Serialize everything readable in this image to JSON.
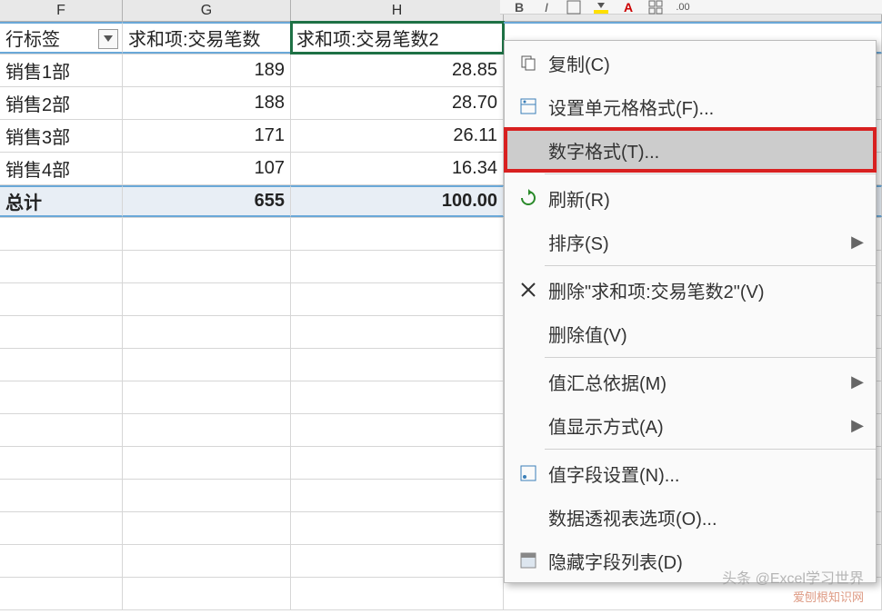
{
  "columns": {
    "F": "F",
    "G": "G",
    "H": "H"
  },
  "pivot": {
    "headers": {
      "row_label": "行标签",
      "sum_field1": "求和项:交易笔数",
      "sum_field2": "求和项:交易笔数2"
    },
    "rows": [
      {
        "label": "销售1部",
        "v1": "189",
        "v2": "28.85"
      },
      {
        "label": "销售2部",
        "v1": "188",
        "v2": "28.70"
      },
      {
        "label": "销售3部",
        "v1": "171",
        "v2": "26.11"
      },
      {
        "label": "销售4部",
        "v1": "107",
        "v2": "16.34"
      }
    ],
    "total": {
      "label": "总计",
      "v1": "655",
      "v2": "100.00"
    }
  },
  "context_menu": {
    "items": [
      {
        "icon": "copy-icon",
        "label": "复制(C)",
        "sep_after": false
      },
      {
        "icon": "format-cells-icon",
        "label": "设置单元格格式(F)...",
        "sep_after": false
      },
      {
        "icon": "",
        "label": "数字格式(T)...",
        "highlighted": true,
        "sep_after": true
      },
      {
        "icon": "refresh-icon",
        "label": "刷新(R)",
        "sep_after": false
      },
      {
        "icon": "",
        "label": "排序(S)",
        "submenu": true,
        "sep_after": true
      },
      {
        "icon": "remove-icon",
        "label": "删除\"求和项:交易笔数2\"(V)",
        "sep_after": false
      },
      {
        "icon": "",
        "label": "删除值(V)",
        "sep_after": true
      },
      {
        "icon": "",
        "label": "值汇总依据(M)",
        "submenu": true,
        "sep_after": false
      },
      {
        "icon": "",
        "label": "值显示方式(A)",
        "submenu": true,
        "sep_after": true
      },
      {
        "icon": "field-settings-icon",
        "label": "值字段设置(N)...",
        "sep_after": false
      },
      {
        "icon": "",
        "label": "数据透视表选项(O)...",
        "sep_after": false
      },
      {
        "icon": "hide-fields-icon",
        "label": "隐藏字段列表(D)",
        "sep_after": false
      }
    ]
  },
  "toolbar": {
    "bold": "B",
    "italic": "I",
    "decimal": ".00"
  },
  "watermark": {
    "line1": "头条 @Excel学习世界",
    "line2": "爱刨根知识网"
  }
}
